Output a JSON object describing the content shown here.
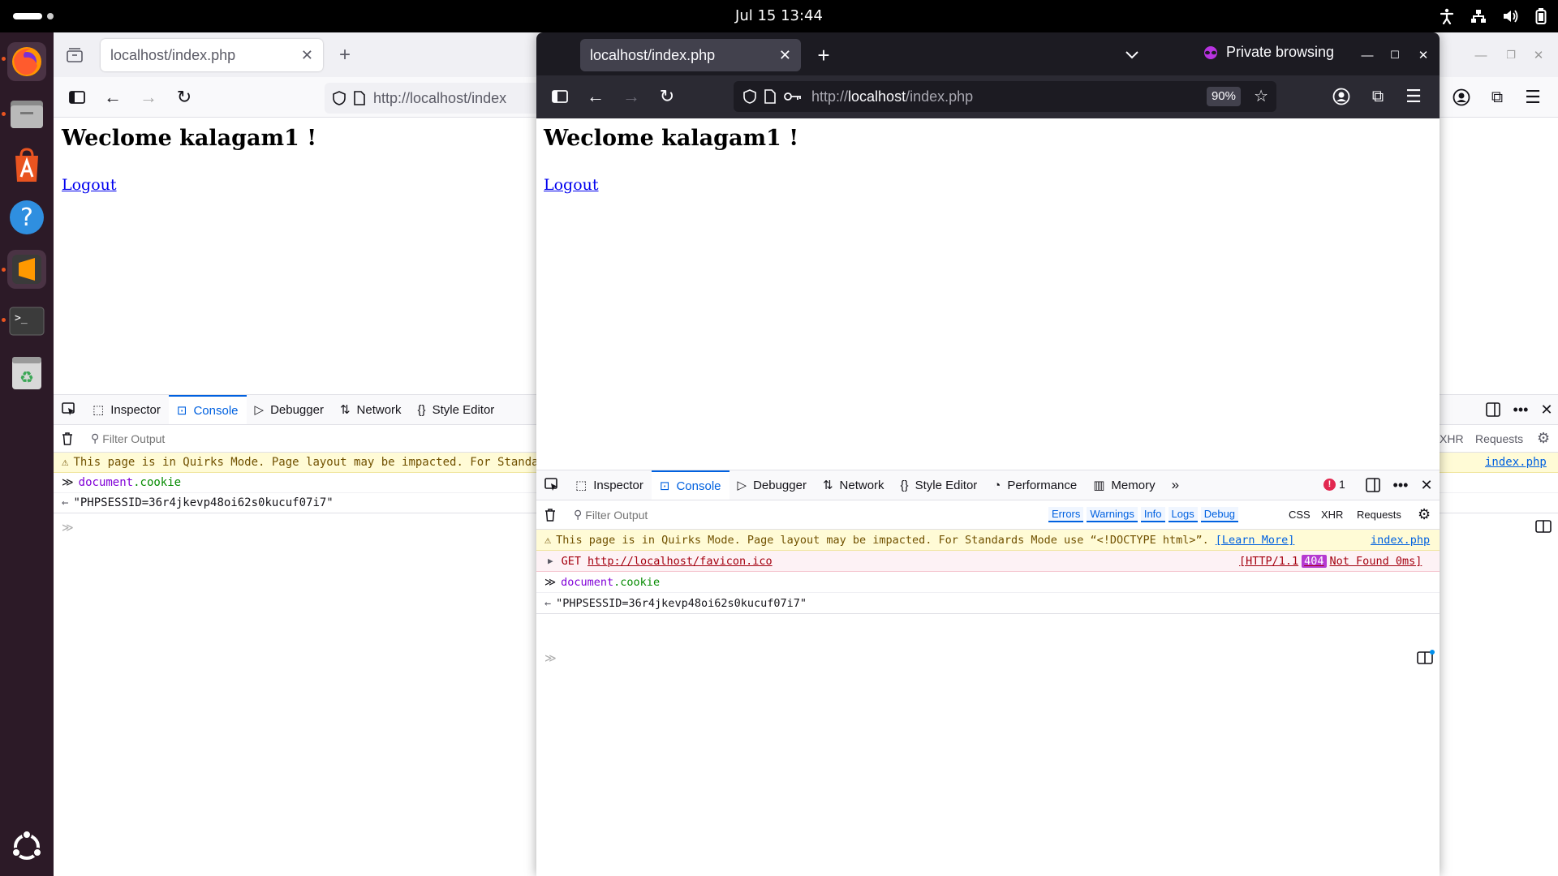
{
  "topbar": {
    "clock": "Jul 15  13:44"
  },
  "dock": {
    "items": [
      "firefox-icon",
      "files-icon",
      "app-center-icon",
      "help-icon",
      "sublime-text-icon",
      "terminal-icon",
      "trash-icon",
      "ubuntu-apps-icon"
    ]
  },
  "bg_window": {
    "tab_title": "localhost/index.php",
    "url": "http://localhost/index",
    "page": {
      "heading": "Weclome kalagam1 !",
      "link": "Logout"
    },
    "devtools": {
      "tabs": [
        "Inspector",
        "Console",
        "Debugger",
        "Network",
        "Style Editor"
      ],
      "filter_placeholder": "Filter Output",
      "right_filters": [
        "XHR",
        "Requests"
      ],
      "warning": "This page is in Quirks Mode. Page layout may be impacted. For Standa",
      "warning_source": "index.php",
      "input": "document.cookie",
      "input_obj": "document",
      "input_prop": ".cookie",
      "output": "\"PHPSESSID=36r4jkevp48oi62s0kucuf07i7\""
    }
  },
  "private_window": {
    "tab_title": "localhost/index.php",
    "private_label": "Private browsing",
    "url_prefix": "http://",
    "url_host": "localhost",
    "url_path": "/index.php",
    "zoom": "90%",
    "page": {
      "heading": "Weclome kalagam1 !",
      "link": "Logout"
    },
    "devtools": {
      "tabs": [
        "Inspector",
        "Console",
        "Debugger",
        "Network",
        "Style Editor",
        "Performance",
        "Memory"
      ],
      "error_count": "1",
      "filter_placeholder": "Filter Output",
      "filters": [
        "Errors",
        "Warnings",
        "Info",
        "Logs",
        "Debug"
      ],
      "right_filters": [
        "CSS",
        "XHR",
        "Requests"
      ],
      "warning": "This page is in Quirks Mode. Page layout may be impacted. For Standards Mode use “<!DOCTYPE html>”.",
      "learn_more": "[Learn More]",
      "warning_source": "index.php",
      "error_method": "GET",
      "error_url": "http://localhost/favicon.ico",
      "error_status_pre": "[HTTP/1.1",
      "error_code": "404",
      "error_status_post": "Not Found 0ms]",
      "input_obj": "document",
      "input_prop": ".cookie",
      "output": "\"PHPSESSID=36r4jkevp48oi62s0kucuf07i7\""
    }
  }
}
